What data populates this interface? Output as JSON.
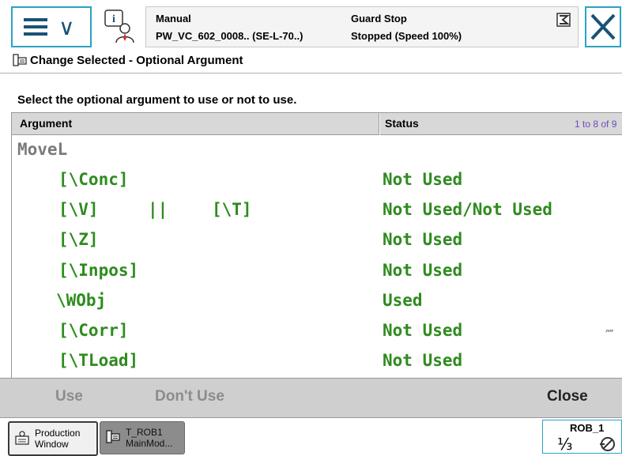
{
  "header": {
    "mode": "Manual",
    "system_name": "PW_VC_602_0008.. (SE-L-70..)",
    "safety_state": "Guard Stop",
    "run_state": "Stopped (Speed 100%)"
  },
  "window": {
    "title": "Change Selected - Optional Argument",
    "instruction": "Select the optional argument to use or not to use."
  },
  "table": {
    "headers": {
      "argument": "Argument",
      "status": "Status"
    },
    "page_range": "1 to 8 of 9",
    "instruction_name": "MoveL",
    "rows": [
      {
        "argument": "[\\Conc]",
        "status": "Not Used"
      },
      {
        "argument": "[\\V]",
        "separator": "||",
        "argument_alt": "[\\T]",
        "status": "Not Used/Not Used"
      },
      {
        "argument": "[\\Z]",
        "status": "Not Used"
      },
      {
        "argument": "[\\Inpos]",
        "status": "Not Used"
      },
      {
        "argument": "\\WObj",
        "status": "Used"
      },
      {
        "argument": "[\\Corr]",
        "status": "Not Used"
      },
      {
        "argument": "[\\TLoad]",
        "status": "Not Used"
      }
    ]
  },
  "actions": {
    "use": "Use",
    "dont_use": "Don't Use",
    "close": "Close"
  },
  "taskbar": {
    "production_line1": "Production",
    "production_line2": "Window",
    "task_line1": "T_ROB1",
    "task_line2": "MainMod..."
  },
  "robot_status": {
    "name": "ROB_1",
    "fraction": "⅓"
  },
  "colors": {
    "accent": "#2aa3c4",
    "arg_green": "#2e8b1e",
    "dim_gray": "#7a7a7a",
    "range_purple": "#6a4bbf"
  },
  "icons": [
    "menu-icon",
    "chevron-down-icon",
    "info-icon",
    "program-icon",
    "close-icon",
    "window-icon",
    "production-icon",
    "robot-icon"
  ]
}
